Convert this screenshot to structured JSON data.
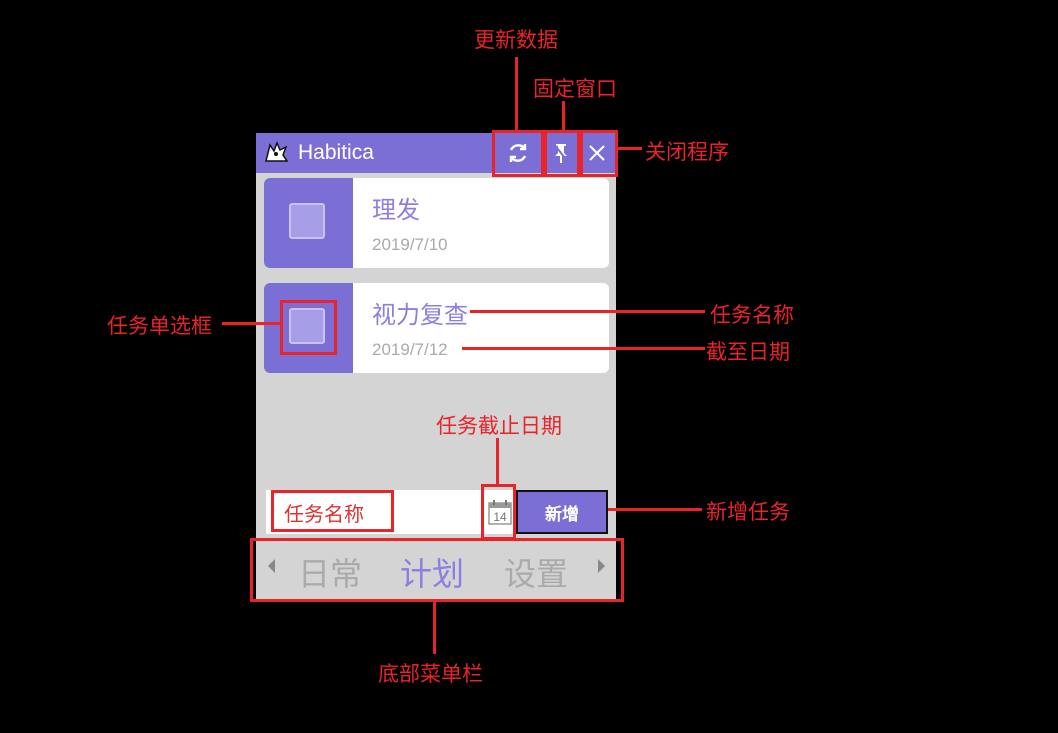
{
  "window": {
    "title": "Habitica",
    "icons": {
      "logo": "habitica-gryphon-icon",
      "refresh": "refresh-icon",
      "pin": "pin-icon",
      "close": "close-icon"
    }
  },
  "tasks": [
    {
      "name": "理发",
      "due": "2019/7/10"
    },
    {
      "name": "视力复查",
      "due": "2019/7/12"
    }
  ],
  "add_task": {
    "input_value": "任务名称",
    "date_picker_day": "14",
    "add_button": "新增"
  },
  "bottom_menu": {
    "tabs": [
      "日常",
      "计划",
      "设置"
    ],
    "active": "计划"
  },
  "annotations": {
    "refresh": "更新数据",
    "pin": "固定窗口",
    "close": "关闭程序",
    "checkbox": "任务单选框",
    "task_name": "任务名称",
    "due_date": "截至日期",
    "task_due_date": "任务截止日期",
    "add_task": "新增任务",
    "bottom_menu": "底部菜单栏"
  },
  "colors": {
    "accent": "#7b6fd6",
    "annotation": "#e8232a",
    "background": "#000000",
    "panel": "#d4d4d4"
  }
}
